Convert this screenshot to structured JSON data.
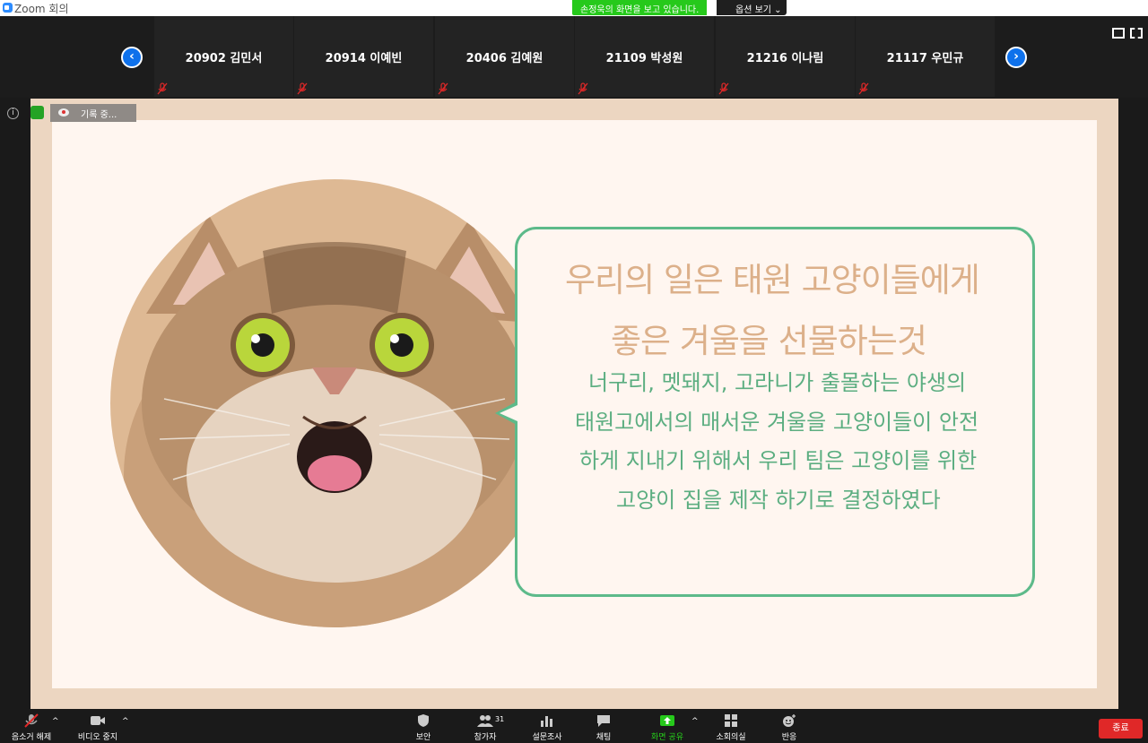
{
  "window": {
    "title": "Zoom 회의"
  },
  "share_banner": {
    "text": "손정욱의 화면을 보고 있습니다.",
    "options_label": "옵션 보기"
  },
  "participants": [
    {
      "name": "20902 김민서"
    },
    {
      "name": "20914 이예빈"
    },
    {
      "name": "20406 김예원"
    },
    {
      "name": "21109 박성원"
    },
    {
      "name": "21216 이나림"
    },
    {
      "name": "21117 우민규"
    }
  ],
  "nav": {
    "prev": "‹",
    "next": "›"
  },
  "recording": {
    "label": "기록 중..."
  },
  "slide": {
    "headline": [
      "우리의 일은 태원 고양이들에게",
      "좋은 겨울을 선물하는것"
    ],
    "body": [
      "너구리, 멧돼지, 고라니가 출몰하는 야생의",
      "태원고에서의 매서운 겨울을 고양이들이 안전",
      "하게 지내기 위해서 우리 팀은 고양이를 위한",
      "고양이 집을 제작 하기로 결정하였다"
    ]
  },
  "toolbar": {
    "mute": "음소거 해제",
    "video": "비디오 중지",
    "security": "보안",
    "participants": "참가자",
    "participants_count": "31",
    "polls": "설문조사",
    "chat": "채팅",
    "share": "화면 공유",
    "breakout": "소회의실",
    "reactions": "반응",
    "end": "종료"
  },
  "colors": {
    "share_green": "#26c91b",
    "accent_blue": "#0e71eb",
    "end_red": "#e02828",
    "headline": "#dcb08a",
    "body_text": "#5cae81",
    "bubble_border": "#5dba8a"
  }
}
